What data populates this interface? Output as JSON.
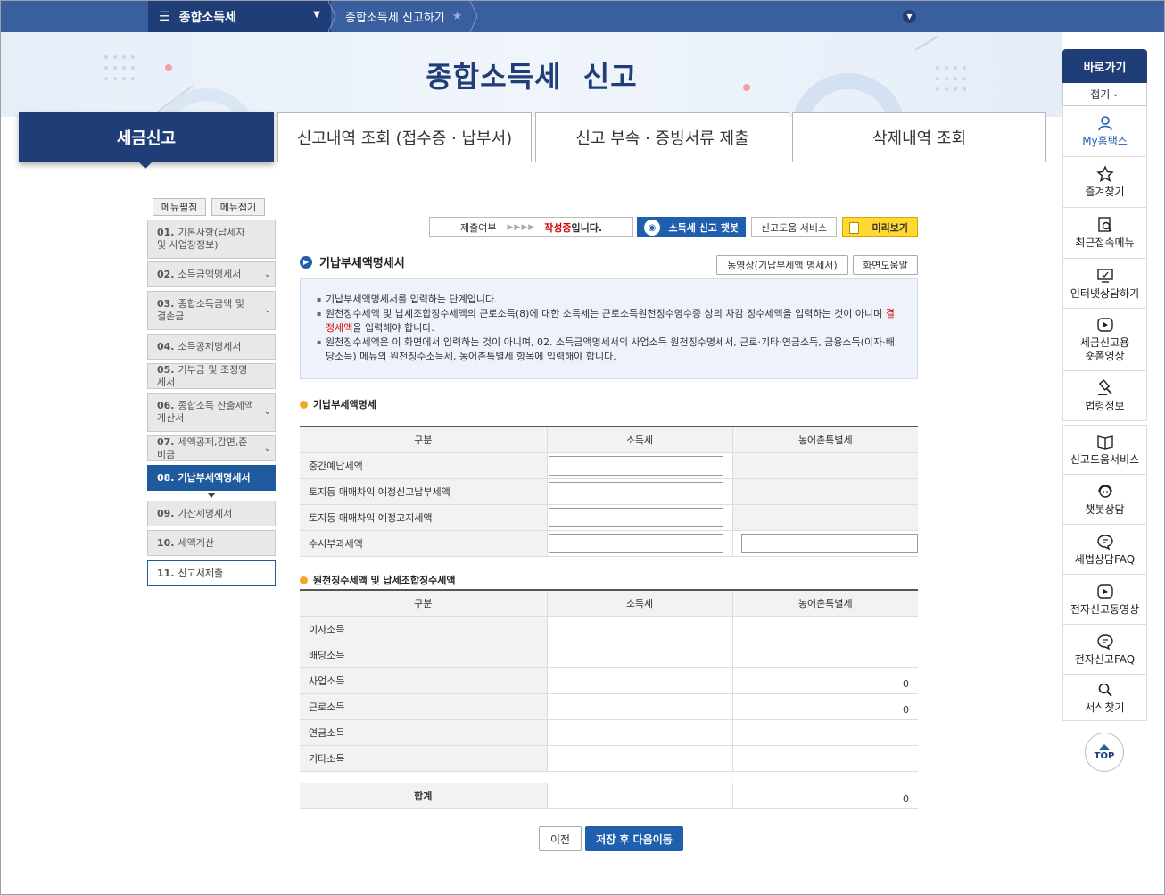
{
  "nav": {
    "menu_label": "종합소득세",
    "breadcrumb": "종합소득세 신고하기"
  },
  "banner": {
    "title": "종합소득세  신고"
  },
  "tabs": [
    {
      "label": "세금신고"
    },
    {
      "label": "신고내역 조회 (접수증 · 납부서)"
    },
    {
      "label": "신고 부속 · 증빙서류 제출"
    },
    {
      "label": "삭제내역 조회"
    }
  ],
  "left_menu": {
    "edit_label": "메뉴펼침",
    "fold_label": "메뉴접기",
    "items": [
      {
        "num": "01.",
        "label": "기본사항(납세자 및 사업장정보)"
      },
      {
        "num": "02.",
        "label": "소득금액명세서"
      },
      {
        "num": "03.",
        "label": "종합소득금액 및 결손금"
      },
      {
        "num": "04.",
        "label": "소득공제명세서"
      },
      {
        "num": "05.",
        "label": "기부금 및 조정명세서"
      },
      {
        "num": "06.",
        "label": "종합소득 산출세액계산서"
      },
      {
        "num": "07.",
        "label": "세액공제,감면,준비금"
      },
      {
        "num": "08.",
        "label": "기납부세액명세서"
      },
      {
        "num": "09.",
        "label": "가산세명세서"
      },
      {
        "num": "10.",
        "label": "세액계산"
      },
      {
        "num": "11.",
        "label": "신고서제출"
      }
    ]
  },
  "status": {
    "label": "제출여부",
    "arrows": "▶▶▶▶",
    "state": "작성중",
    "suffix": "입니다.",
    "chatbot_label": "소득세 신고 챗봇",
    "help_label": "신고도움 서비스",
    "preview_label": "미리보기"
  },
  "section": {
    "title": "기납부세액명세서",
    "video_btn": "동영상(기납부세액 명세서)",
    "help_btn": "화면도움말"
  },
  "info": {
    "line1": "기납부세액명세서를 입력하는 단계입니다.",
    "line2a": "원천징수세액 및 납세조합징수세액의 근로소득(8)에 대한 소득세는 근로소득원천징수영수증 상의 차감 징수세액을 입력하는 것이 아니며 ",
    "line2_red": "결정세액",
    "line2b": "을 입력해야 합니다.",
    "line3": "원천징수세액은 이 화면에서 입력하는 것이 아니며, 02. 소득금액명세서의 사업소득 원천징수명세서, 근로·기타·연금소득, 금융소득(이자·배당소득) 메뉴의 원천징수소득세, 농어촌특별세 항목에 입력해야 합니다."
  },
  "table1": {
    "title": "기납부세액명세",
    "headers": [
      "구분",
      "소득세",
      "농어촌특별세"
    ],
    "rows": [
      {
        "label": "중간예납세액"
      },
      {
        "label": "토지등 매매차익 예정신고납부세액"
      },
      {
        "label": "토지등 매매차익 예정고지세액"
      },
      {
        "label": "수시부과세액"
      }
    ]
  },
  "table2": {
    "title": "원천징수세액 및 납세조합징수세액",
    "headers": [
      "구분",
      "소득세",
      "농어촌특별세"
    ],
    "rows": [
      {
        "label": "이자소득",
        "tax": "",
        "rural": ""
      },
      {
        "label": "배당소득",
        "tax": "",
        "rural": ""
      },
      {
        "label": "사업소득",
        "tax": "",
        "rural": "0"
      },
      {
        "label": "근로소득",
        "tax": "",
        "rural": "0"
      },
      {
        "label": "연금소득",
        "tax": "",
        "rural": ""
      },
      {
        "label": "기타소득",
        "tax": "",
        "rural": ""
      }
    ],
    "total_label": "합계",
    "total_tax": "",
    "total_rural": "0"
  },
  "buttons": {
    "prev": "이전",
    "next": "저장 후 다음이동"
  },
  "quickbar": {
    "title": "바로가기",
    "fold": "접기",
    "items": [
      {
        "label": "My홈택스",
        "icon": "person-icon"
      },
      {
        "label": "즐겨찾기",
        "icon": "star-icon"
      },
      {
        "label": "최근접속메뉴",
        "icon": "recent-search-icon"
      },
      {
        "label": "인터넷상담하기",
        "icon": "monitor-chat-icon"
      },
      {
        "label": "세금신고용 숏폼영상",
        "icon": "play-icon"
      },
      {
        "label": "법령정보",
        "icon": "gavel-icon"
      },
      {
        "label": "신고도움서비스",
        "icon": "book-icon"
      },
      {
        "label": "챗봇상담",
        "icon": "headset-icon"
      },
      {
        "label": "세법상담FAQ",
        "icon": "chat-bubble-icon"
      },
      {
        "label": "전자신고동영상",
        "icon": "play-icon"
      },
      {
        "label": "전자신고FAQ",
        "icon": "chat-bubble-icon"
      },
      {
        "label": "서식찾기",
        "icon": "search-icon"
      }
    ],
    "top_label": "TOP"
  }
}
